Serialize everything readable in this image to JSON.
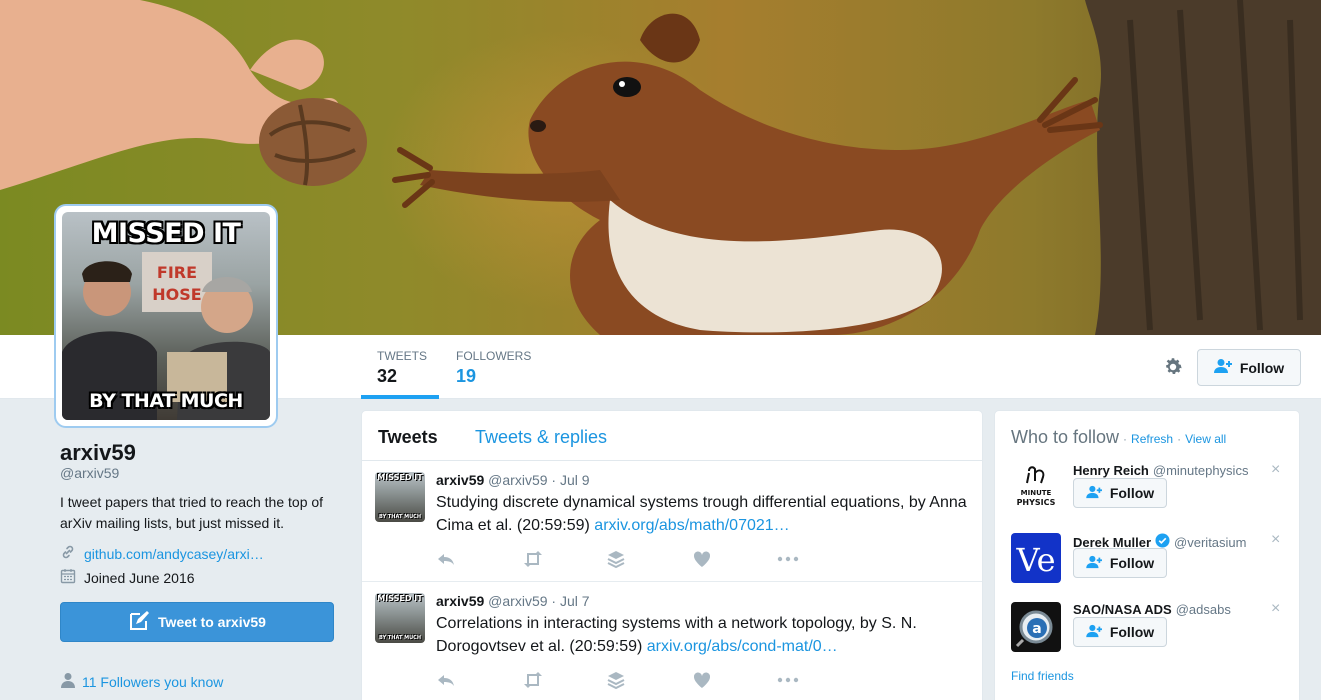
{
  "banner": {
    "alt": "squirrel reaching for walnut"
  },
  "profile": {
    "avatar_top_text": "MISSED IT",
    "avatar_bottom_text": "BY THAT MUCH",
    "name": "arxiv59",
    "handle": "@arxiv59",
    "bio": "I tweet papers that tried to reach the top of arXiv mailing lists, but just missed it.",
    "link": "github.com/andycasey/arxi…",
    "joined": "Joined June 2016",
    "tweet_to_label": "Tweet to arxiv59",
    "followers_you_know": "11 Followers you know"
  },
  "stats": {
    "tweets_label": "TWEETS",
    "tweets_value": "32",
    "followers_label": "FOLLOWERS",
    "followers_value": "19"
  },
  "actions": {
    "follow_label": "Follow"
  },
  "timeline": {
    "tabs": [
      {
        "label": "Tweets"
      },
      {
        "label": "Tweets & replies"
      }
    ],
    "tweets": [
      {
        "name": "arxiv59",
        "handle": "@arxiv59",
        "date": "· Jul 9",
        "text": "Studying discrete dynamical systems trough differential equations, by Anna Cima et al. (20:59:59) ",
        "link": "arxiv.org/abs/math/07021…"
      },
      {
        "name": "arxiv59",
        "handle": "@arxiv59",
        "date": "· Jul 7",
        "text": "Correlations in interacting systems with a network topology, by S. N. Dorogovtsev et al. (20:59:59) ",
        "link": "arxiv.org/abs/cond-mat/0…"
      }
    ],
    "avatar_top_text": "MISSED IT",
    "avatar_bottom_text": "BY THAT MUCH"
  },
  "who_to_follow": {
    "title": "Who to follow",
    "separator": "·",
    "refresh": "Refresh",
    "view_all": "View all",
    "find_friends": "Find friends",
    "close_glyph": "×",
    "suggestions": [
      {
        "name": "Henry Reich",
        "handle": "@minutephysics",
        "avatar_text_1": "MINUTE",
        "avatar_text_2": "PHYSICS",
        "verified": false,
        "follow_label": "Follow"
      },
      {
        "name": "Derek Muller",
        "handle": "@veritasium",
        "avatar_text_1": "Ve",
        "verified": true,
        "follow_label": "Follow"
      },
      {
        "name": "SAO/NASA ADS",
        "handle": "@adsabs",
        "avatar_text_1": "a",
        "verified": false,
        "follow_label": "Follow"
      }
    ]
  },
  "colors": {
    "accent": "#1da1f2",
    "link": "#1b95e0",
    "tweet_button": "#3b94d9"
  }
}
